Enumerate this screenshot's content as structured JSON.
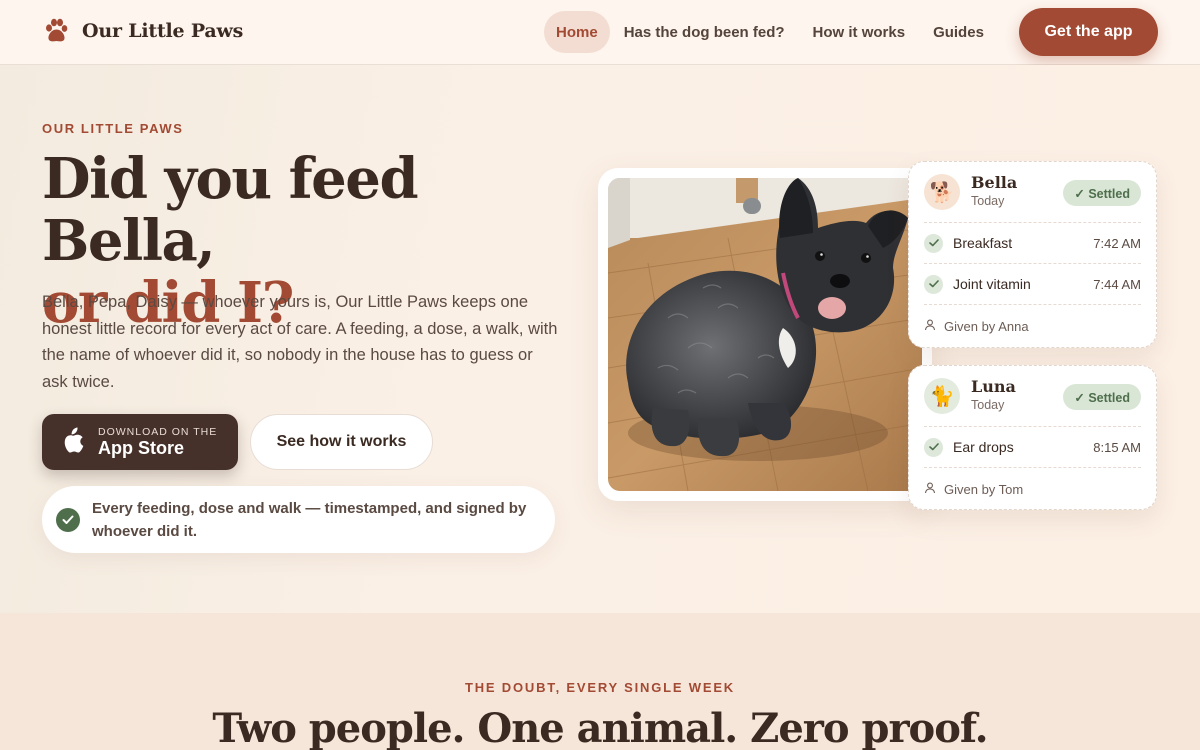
{
  "header": {
    "brand": "Our Little Paws",
    "nav": [
      {
        "label": "Home",
        "active": true
      },
      {
        "label": "Has the dog been fed?",
        "active": false
      },
      {
        "label": "How it works",
        "active": false
      },
      {
        "label": "Guides",
        "active": false
      }
    ],
    "cta_label": "Get the app"
  },
  "hero": {
    "eyebrow": "OUR LITTLE PAWS",
    "title_line1": "Did you feed Bella,",
    "title_line2": "or did I?",
    "lead": "Bella, Pepa, Daisy — whoever yours is, Our Little Paws keeps one honest little record for every act of care. A feeding, a dose, a walk, with the name of whoever did it, so nobody in the house has to guess or ask twice.",
    "store_small": "DOWNLOAD ON THE",
    "store_big": "App Store",
    "how_label": "See how it works",
    "proof_text": "Every feeding, dose and walk — timestamped, and signed by whoever did it."
  },
  "cards": [
    {
      "name": "Bella",
      "day": "Today",
      "avatar": "🐕",
      "badge": "✓ Settled",
      "rows": [
        {
          "label": "Breakfast",
          "time": "7:42 AM"
        },
        {
          "label": "Joint vitamin",
          "time": "7:44 AM"
        }
      ],
      "given_by": "Given by Anna"
    },
    {
      "name": "Luna",
      "day": "Today",
      "avatar": "🐈",
      "badge": "✓ Settled",
      "rows": [
        {
          "label": "Ear drops",
          "time": "8:15 AM"
        }
      ],
      "given_by": "Given by Tom"
    }
  ],
  "doubt": {
    "eyebrow": "THE DOUBT, EVERY SINGLE WEEK",
    "title": "Two people. One animal. Zero proof."
  },
  "colors": {
    "accent": "#a24a33",
    "dark": "#3a2a22",
    "green": "#4f6f4c",
    "badge_bg": "#d9e6d6"
  }
}
